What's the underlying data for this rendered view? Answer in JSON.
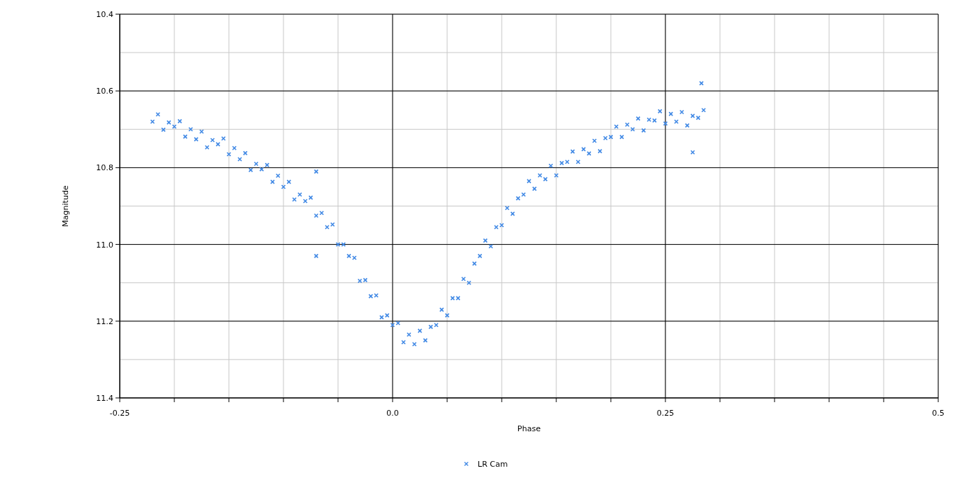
{
  "chart": {
    "chart_data": {
      "type": "scatter",
      "grid": true,
      "xlabel": "Phase",
      "ylabel": "Magnitude",
      "xlim": [
        -0.25,
        0.5
      ],
      "ylim": [
        11.4,
        10.4
      ],
      "xticks": [
        {
          "value": -0.25,
          "label": "-0.25"
        },
        {
          "value": 0,
          "label": "0.0"
        },
        {
          "value": 0.25,
          "label": "0.25"
        },
        {
          "value": 0.5,
          "label": "0.5"
        }
      ],
      "yticks": [
        {
          "value": 10.4,
          "label": "10.4"
        },
        {
          "value": 10.6,
          "label": "10.6"
        },
        {
          "value": 10.8,
          "label": "10.8"
        },
        {
          "value": 11,
          "label": "11.0"
        },
        {
          "value": 11.2,
          "label": "11.2"
        },
        {
          "value": 11.4,
          "label": "11.4"
        }
      ],
      "x": [
        -0.22,
        -0.215,
        -0.21,
        -0.205,
        -0.2,
        -0.195,
        -0.19,
        -0.185,
        -0.18,
        -0.175,
        -0.17,
        -0.165,
        -0.16,
        -0.155,
        -0.15,
        -0.145,
        -0.14,
        -0.135,
        -0.13,
        -0.125,
        -0.12,
        -0.115,
        -0.11,
        -0.105,
        -0.1,
        -0.095,
        -0.09,
        -0.085,
        -0.08,
        -0.075,
        -0.07,
        -0.065,
        -0.06,
        -0.055,
        -0.05,
        -0.045,
        -0.04,
        -0.035,
        -0.03,
        -0.025,
        -0.02,
        -0.015,
        -0.01,
        -0.005,
        0,
        0.005,
        0.01,
        0.015,
        0.02,
        0.025,
        0.03,
        0.035,
        0.04,
        0.045,
        0.05,
        0.055,
        0.06,
        0.065,
        0.07,
        0.075,
        0.08,
        0.085,
        0.09,
        0.095,
        0.1,
        0.105,
        0.11,
        0.115,
        0.12,
        0.125,
        0.13,
        0.135,
        0.14,
        0.145,
        0.15,
        0.155,
        0.16,
        0.165,
        0.17,
        0.175,
        0.18,
        0.185,
        0.19,
        0.195,
        0.2,
        0.205,
        0.21,
        0.215,
        0.22,
        0.225,
        0.23,
        0.235,
        0.24,
        0.245,
        0.25,
        0.255,
        0.26,
        0.265,
        0.27,
        0.275,
        0.28,
        0.285,
        0.283,
        0.275,
        -0.07,
        -0.07
      ],
      "series": [
        {
          "name": "LR Cam",
          "color": "#4189e5",
          "values": [
            10.68,
            10.661,
            10.701,
            10.682,
            10.693,
            10.679,
            10.719,
            10.7,
            10.726,
            10.706,
            10.747,
            10.728,
            10.739,
            10.724,
            10.765,
            10.749,
            10.778,
            10.762,
            10.806,
            10.79,
            10.804,
            10.793,
            10.837,
            10.821,
            10.85,
            10.837,
            10.883,
            10.87,
            10.887,
            10.878,
            10.925,
            10.918,
            10.955,
            10.948,
            11.0,
            11.0,
            11.03,
            11.035,
            11.095,
            11.093,
            11.135,
            11.133,
            11.19,
            11.185,
            11.21,
            11.205,
            11.255,
            11.235,
            11.26,
            11.225,
            11.25,
            11.215,
            11.21,
            11.17,
            11.185,
            11.14,
            11.14,
            11.09,
            11.1,
            11.05,
            11.03,
            10.99,
            11.005,
            10.955,
            10.95,
            10.905,
            10.92,
            10.88,
            10.87,
            10.835,
            10.855,
            10.82,
            10.83,
            10.795,
            10.82,
            10.788,
            10.785,
            10.758,
            10.785,
            10.752,
            10.763,
            10.73,
            10.757,
            10.723,
            10.72,
            10.693,
            10.72,
            10.688,
            10.7,
            10.672,
            10.703,
            10.675,
            10.677,
            10.653,
            10.685,
            10.66,
            10.68,
            10.655,
            10.69,
            10.665,
            10.67,
            10.65,
            10.58,
            10.76,
            11.03,
            10.81
          ]
        }
      ]
    }
  }
}
